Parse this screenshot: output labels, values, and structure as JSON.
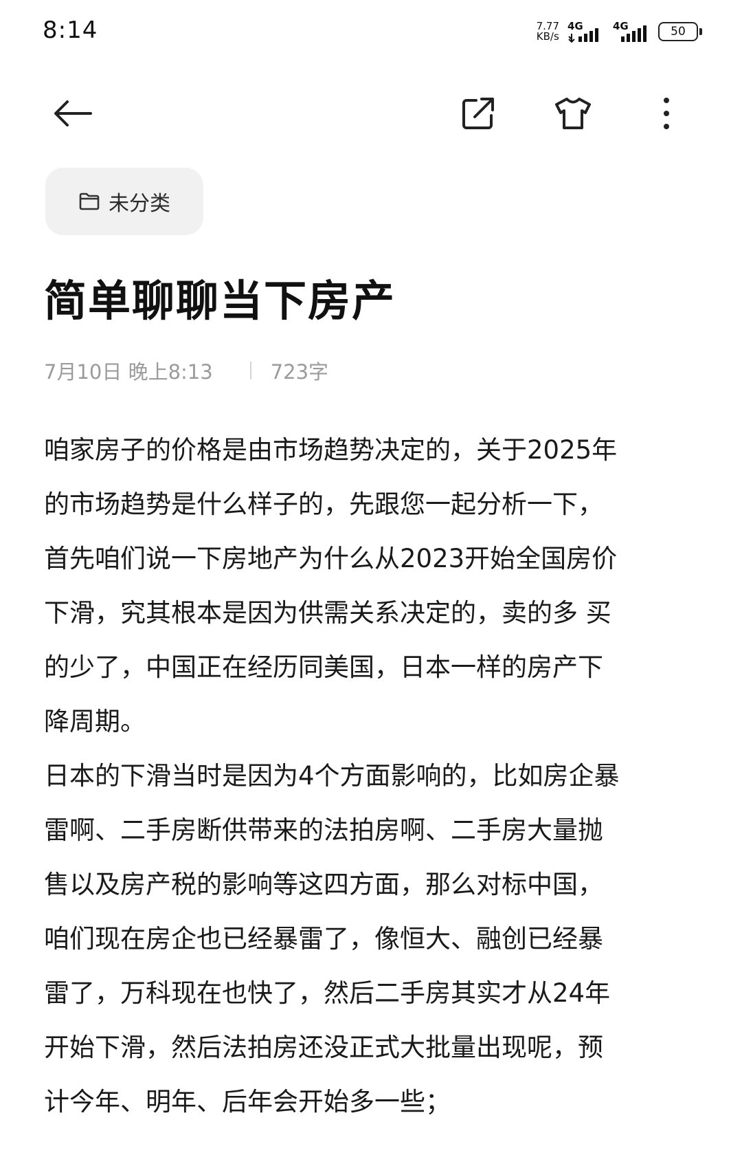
{
  "status_bar": {
    "time": "8:14",
    "net_speed_value": "7.77",
    "net_speed_unit": "KB/s",
    "signal1_label": "4G",
    "signal2_label": "4G",
    "battery": "50"
  },
  "toolbar": {
    "back_icon": "arrow-left-icon",
    "share_icon": "share-icon",
    "theme_icon": "shirt-icon",
    "more_icon": "more-vertical-icon"
  },
  "category": {
    "icon": "folder-icon",
    "label": "未分类"
  },
  "note": {
    "title": "简单聊聊当下房产",
    "date": "7月10日 晚上8:13",
    "word_count": "723字",
    "body_lines": [
      "咱家房子的价格是由市场趋势决定的，关于2025年",
      "的市场趋势是什么样子的，先跟您一起分析一下，",
      "首先咱们说一下房地产为什么从2023开始全国房价",
      "下滑，究其根本是因为供需关系决定的，卖的多 买",
      "的少了，中国正在经历同美国，日本一样的房产下",
      "降周期。",
      "日本的下滑当时是因为4个方面影响的，比如房企暴",
      "雷啊、二手房断供带来的法拍房啊、二手房大量抛",
      "售以及房产税的影响等这四方面，那么对标中国，",
      "咱们现在房企也已经暴雷了，像恒大、融创已经暴",
      "雷了，万科现在也快了，然后二手房其实才从24年",
      "开始下滑，然后法拍房还没正式大批量出现呢，预",
      "计今年、明年、后年会开始多一些；"
    ]
  }
}
